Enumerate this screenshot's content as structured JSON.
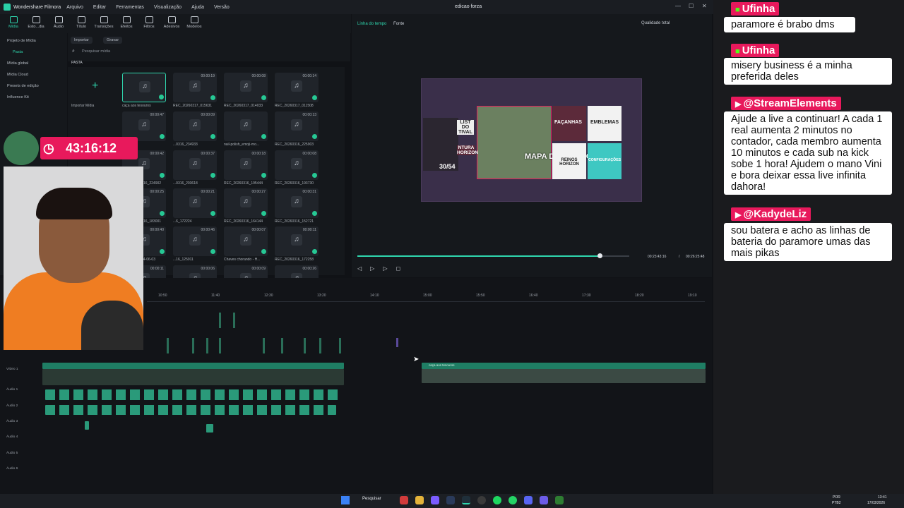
{
  "window": {
    "brand": "Wondershare Filmora",
    "document_title": "edicao forza",
    "menu": [
      "Arquivo",
      "Editar",
      "Ferramentas",
      "Visualização",
      "Ajuda",
      "Versão"
    ],
    "export_label": "Exportar"
  },
  "toolbar": [
    "Mídia",
    "Esto...dia",
    "Áudio",
    "Título",
    "Transições",
    "Efeitos",
    "Filtros",
    "Adesivos",
    "Modelos"
  ],
  "library": {
    "items": [
      "Projeto de Mídia",
      "Pasta",
      "Mídia global",
      "Mídia Cloud",
      "Presets de edição",
      "Influence Kit"
    ]
  },
  "media": {
    "import_label": "Importar",
    "record_label": "Gravar",
    "search_placeholder": "Pesquisar mídia",
    "folder_label": "PASTA",
    "import_media_label": "Importar Mídia",
    "cells": [
      {
        "name": "caça aos tesouros",
        "dur": ""
      },
      {
        "name": "REC_20260317_015631",
        "dur": "00:00:19"
      },
      {
        "name": "REC_20260317_014033",
        "dur": "00:00:08"
      },
      {
        "name": "REC_20260317_011508",
        "dur": "00:00:14"
      },
      {
        "name": "",
        "dur": "00:00:47"
      },
      {
        "name": "...0316_234933",
        "dur": "00:00:09"
      },
      {
        "name": "nail-polish_emoji-mo...",
        "dur": ""
      },
      {
        "name": "REC_20260316_225903",
        "dur": "00:00:13"
      },
      {
        "name": "REC_20260316_224902",
        "dur": "00:00:42"
      },
      {
        "name": "...0316_203618",
        "dur": "00:00:37"
      },
      {
        "name": "REC_20260316_195444",
        "dur": "00:00:18"
      },
      {
        "name": "REC_20260316_193730",
        "dur": "00:00:08"
      },
      {
        "name": "REC_20260316_183001",
        "dur": "00:00:25"
      },
      {
        "name": "...6_172224",
        "dur": "00:00:21"
      },
      {
        "name": "REC_20260316_164144",
        "dur": "00:00:27"
      },
      {
        "name": "REC_20260316_152721",
        "dur": "00:00:31"
      },
      {
        "name": "2026-03-18 14-06-03",
        "dur": "00:00:40"
      },
      {
        "name": "...16_125911",
        "dur": "00:00:46"
      },
      {
        "name": "Chaves chorando - H...",
        "dur": "00:00:07"
      },
      {
        "name": "REC_20260316_172258",
        "dur": "00:00:11"
      },
      {
        "name": "REC_20260316_165409",
        "dur": "00:00:11"
      },
      {
        "name": "",
        "dur": "00:00:06"
      },
      {
        "name": "",
        "dur": "00:00:09"
      },
      {
        "name": "",
        "dur": "00:00:26"
      }
    ]
  },
  "preview": {
    "tab_timeline": "Linha do tempo",
    "tab_source": "Fonte",
    "quality": "Qualidade total",
    "current_time": "00:23:43:16",
    "total_time": "00:26:25:48",
    "progress": 0.89
  },
  "game": {
    "tiles": [
      "FAÇANHAS",
      "EMBLEMAS",
      "MAPA DO MUNDO",
      "REINOS HORIZON",
      "CONFIGURAÇÕES",
      "30/54",
      "LIST DO TIVAL",
      "NTURA HORIZON"
    ]
  },
  "timeline": {
    "ruler": [
      "10:50",
      "11:40",
      "12:30",
      "13:20",
      "14:10",
      "15:00",
      "15:50",
      "16:40",
      "17:30",
      "18:20",
      "19:10"
    ],
    "tracks": [
      "Vídeo 1",
      "Áudio 1",
      "Áudio 2",
      "Áudio 3",
      "Áudio 4",
      "Áudio 5",
      "Áudio 6"
    ],
    "clip_labels": [
      "caça aos tesouros",
      "gif",
      "gif"
    ]
  },
  "stream": {
    "timer": "43:16:12"
  },
  "chat": [
    {
      "user": "Ufinha",
      "text": "paramore é brabo dms",
      "badge": "kick"
    },
    {
      "user": "Ufinha",
      "text": "misery business é a minha preferida deles",
      "badge": "kick"
    },
    {
      "user": "@StreamElements",
      "text": "Ajude a live a continuar! A cada 1 real aumenta 2 minutos no contador, cada membro aumenta 10 minutos e cada sub na kick sobe 1 hora! Ajudem o mano Vini e bora deixar essa live infinita dahora!",
      "badge": "youtube"
    },
    {
      "user": "@KadydeLiz",
      "text": "sou batera e acho as linhas de bateria do paramore umas das mais pikas",
      "badge": "youtube"
    }
  ],
  "taskbar": {
    "search": "Pesquisar",
    "lang": "POR",
    "layout": "PTB2",
    "time": "13:41",
    "date": "17/03/2026"
  },
  "colors": {
    "accent": "#2fd6ae",
    "chat_badge": "#e8195c",
    "timer_bg": "#e8195c"
  }
}
